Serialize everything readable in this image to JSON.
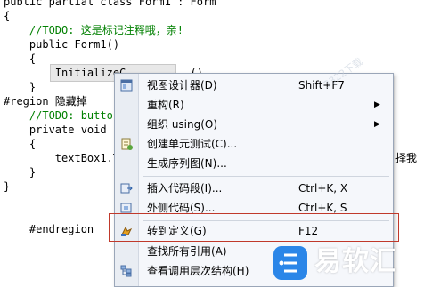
{
  "editor": {
    "lines": [
      {
        "plain": "public partial class Form1 : Form",
        "kw": ""
      },
      {
        "plain": "{",
        "kw": ""
      },
      {
        "plain": "    //TODO: 这是标记注释哦，亲!",
        "kw": ""
      },
      {
        "plain": "    public Form1()",
        "kw": ""
      },
      {
        "plain": "    {",
        "kw": ""
      },
      {
        "plain": "        InitializeC          ()",
        "kw": ""
      },
      {
        "plain": "    }",
        "kw": ""
      },
      {
        "plain": "#region 隐藏掉",
        "kw": ""
      },
      {
        "plain": "    //TODO: button",
        "kw": ""
      },
      {
        "plain": "    private void bu",
        "kw": ""
      },
      {
        "plain": "    {",
        "kw": ""
      },
      {
        "plain": "        textBox1.T",
        "kw": ""
      },
      {
        "plain": "    }",
        "kw": ""
      },
      {
        "plain": "}",
        "kw": ""
      },
      {
        "plain": "",
        "kw": ""
      },
      {
        "plain": "",
        "kw": ""
      },
      {
        "plain": "    #endregion",
        "kw": ""
      }
    ],
    "right_fragment": "择我"
  },
  "context_menu": {
    "items": [
      {
        "label": "视图设计器(D)",
        "shortcut": "Shift+F7",
        "icon": "view-designer-icon",
        "arrow": false
      },
      {
        "label": "重构(R)",
        "shortcut": "",
        "icon": "",
        "arrow": true
      },
      {
        "label": "组织 using(O)",
        "shortcut": "",
        "icon": "",
        "arrow": true
      },
      {
        "label": "创建单元测试(C)...",
        "shortcut": "",
        "icon": "unit-test-icon",
        "arrow": false
      },
      {
        "label": "生成序列图(N)...",
        "shortcut": "",
        "icon": "",
        "arrow": false
      },
      {
        "label": "插入代码段(I)...",
        "shortcut": "Ctrl+K, X",
        "icon": "insert-snippet-icon",
        "arrow": false
      },
      {
        "label": "外侧代码(S)...",
        "shortcut": "Ctrl+K, S",
        "icon": "surround-with-icon",
        "arrow": false
      },
      {
        "label": "转到定义(G)",
        "shortcut": "F12",
        "icon": "go-to-definition-icon",
        "arrow": false
      },
      {
        "label": "查找所有引用(A)",
        "shortcut": "",
        "icon": "",
        "arrow": false
      },
      {
        "label": "查看调用层次结构(H)",
        "shortcut": "",
        "icon": "call-hierarchy-icon",
        "arrow": false
      }
    ]
  },
  "watermark": "3322下载",
  "logo": {
    "text": "易软汇"
  },
  "colors": {
    "comment": "#008000",
    "keyword": "#0000ff",
    "menu_bg": "#f5f7fb",
    "highlight_box": "#c0392b",
    "logo_blue": "#2b86e8"
  }
}
